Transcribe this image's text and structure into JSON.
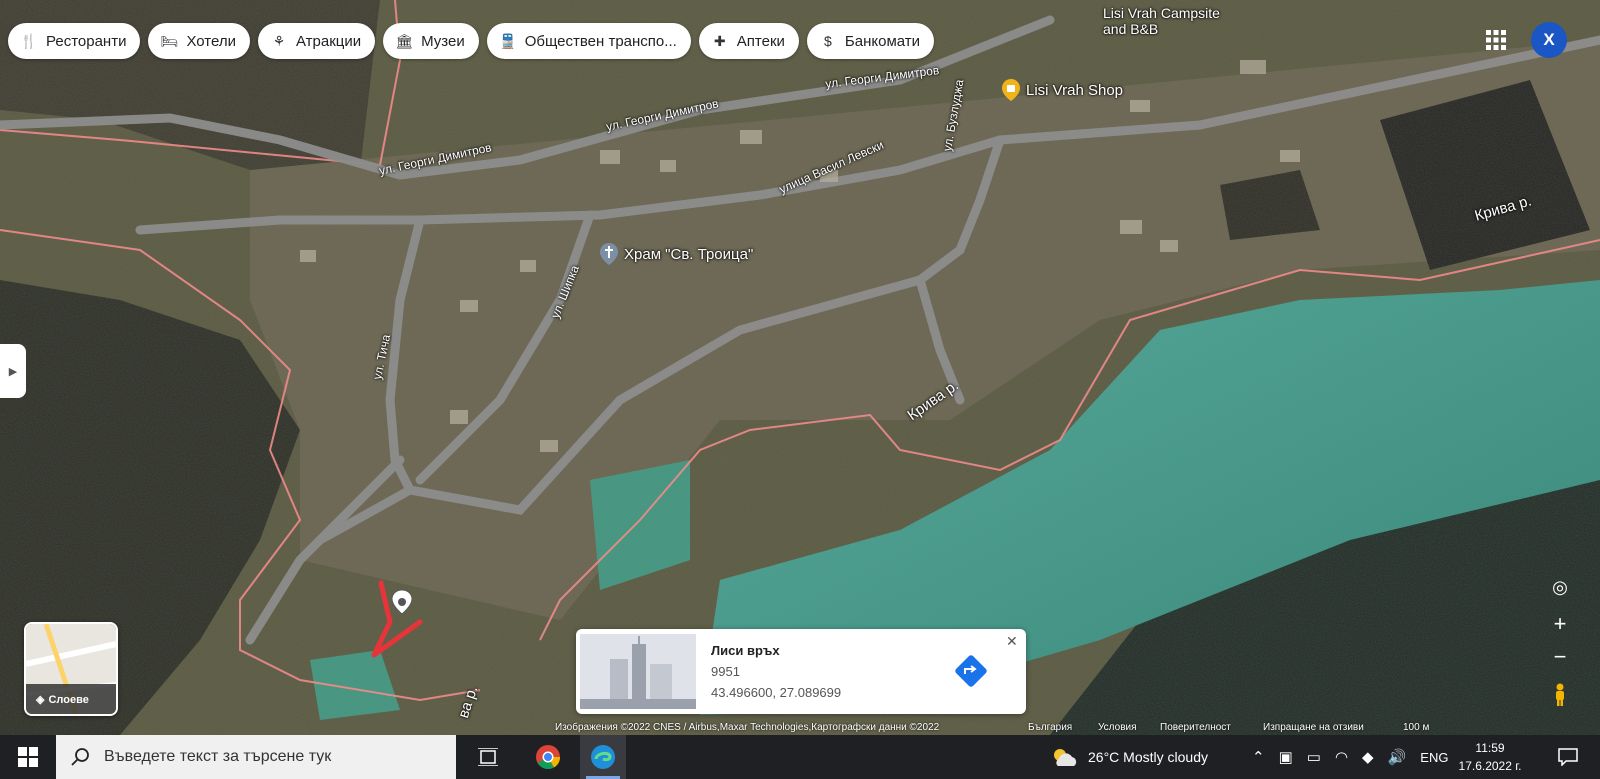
{
  "chips": [
    {
      "icon": "restaurant-icon",
      "label": "Ресторанти"
    },
    {
      "icon": "hotel-icon",
      "label": "Хотели"
    },
    {
      "icon": "attraction-icon",
      "label": "Атракции"
    },
    {
      "icon": "museum-icon",
      "label": "Музеи"
    },
    {
      "icon": "transit-icon",
      "label": "Обществен транспо..."
    },
    {
      "icon": "pharmacy-icon",
      "label": "Аптеки"
    },
    {
      "icon": "atm-icon",
      "label": "Банкомати"
    }
  ],
  "account": {
    "initial": "X",
    "color": "#1a56c4"
  },
  "map_labels": {
    "street_dimitrov_1": "ул. Георги Димитров",
    "street_dimitrov_2": "ул. Георги Димитров",
    "street_dimitrov_3": "ул. Георги Димитров",
    "street_levski": "улица Васил Левски",
    "street_buzludzha": "ул. Бузлуджа",
    "street_shipka": "ул. Шипка",
    "street_ticha": "ул. Тича",
    "campsite": "Lisi Vrah Campsite\nand B&B",
    "shop": "Lisi Vrah Shop",
    "church": "Храм \"Св. Троица\"",
    "river_1": "Крива р.",
    "river_2": "Крива р.",
    "river_3": "ва р."
  },
  "place_card": {
    "name": "Лиси връх",
    "zip": "9951",
    "coords": "43.496600, 27.089699"
  },
  "layers": {
    "label": "Слоеве"
  },
  "attribution": {
    "imagery": "Изображения ©2022 CNES / Airbus,Maxar Technologies,Картографски данни ©2022",
    "country": "България",
    "terms": "Условия",
    "privacy": "Поверителност",
    "feedback": "Изпращане на отзиви",
    "scale": "100 м"
  },
  "taskbar": {
    "search_placeholder": "Въведете текст за търсене тук",
    "weather": "26°C  Mostly cloudy",
    "lang": "ENG",
    "time": "11:59",
    "date": "17.6.2022 г."
  },
  "colors": {
    "pin_red": "#e8333a",
    "boundary": "#f08b8b",
    "road": "#8d8d8d",
    "field": "#3a9a8a"
  }
}
